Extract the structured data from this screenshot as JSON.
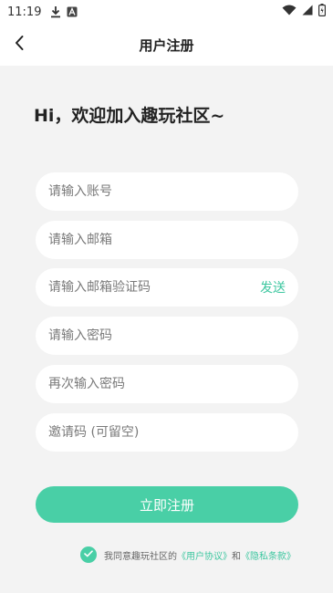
{
  "status_bar": {
    "time": "11:19",
    "icons": [
      "download-icon",
      "app-a-icon",
      "wifi-icon",
      "signal-icon",
      "battery-icon"
    ]
  },
  "app_bar": {
    "title": "用户注册",
    "back_icon": "chevron-left-icon"
  },
  "greeting": "Hi，欢迎加入趣玩社区~",
  "form": {
    "account_placeholder": "请输入账号",
    "email_placeholder": "请输入邮箱",
    "code_placeholder": "请输入邮箱验证码",
    "send_label": "发送",
    "password_placeholder": "请输入密码",
    "password_confirm_placeholder": "再次输入密码",
    "invite_placeholder": "邀请码 (可留空)",
    "submit_label": "立即注册"
  },
  "agreement": {
    "checked": true,
    "prefix": "我同意趣玩社区的",
    "user_agreement": "《用户协议》",
    "and": "和",
    "privacy": "《隐私条款》"
  },
  "colors": {
    "accent": "#49cfa6",
    "link": "#3ec7a0",
    "background": "#f3f3f3"
  }
}
